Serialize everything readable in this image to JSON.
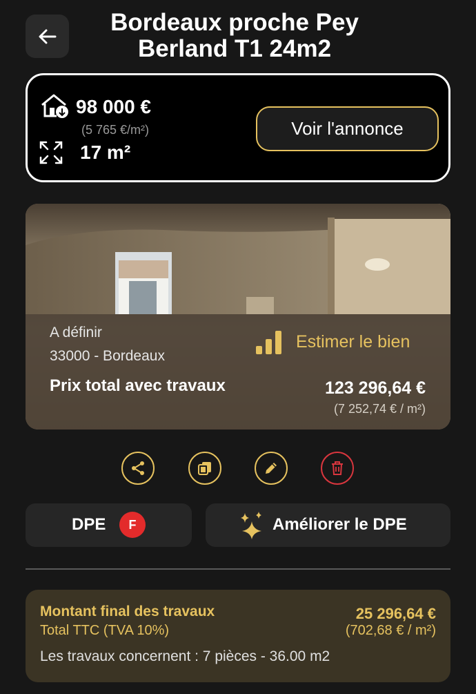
{
  "header": {
    "title": "Bordeaux proche Pey Berland T1 24m2",
    "back_icon": "arrow-left-icon"
  },
  "summary": {
    "price": "98 000 €",
    "price_per_m2": "(5 765 €/m²)",
    "surface": "17 m²",
    "cta_label": "Voir l'annonce",
    "accent_color": "#e6c25f"
  },
  "property": {
    "location_name": "A définir",
    "location_city": "33000 - Bordeaux",
    "estimate_label": "Estimer le bien",
    "total_label": "Prix total avec travaux",
    "total_value": "123 296,64 €",
    "total_per_m2": "(7 252,74 € / m²)"
  },
  "actions": [
    {
      "icon": "share-icon"
    },
    {
      "icon": "copy-icon"
    },
    {
      "icon": "pencil-icon"
    },
    {
      "icon": "trash-icon"
    }
  ],
  "dpe": {
    "label": "DPE",
    "grade": "F",
    "grade_color": "#e32b2b",
    "improve_label": "Améliorer le DPE"
  },
  "works": {
    "title": "Montant final des travaux",
    "subtitle": "Total TTC (TVA 10%)",
    "total": "25 296,64 €",
    "per_m2": "(702,68 € / m²)",
    "description": "Les travaux concernent : 7 pièces - 36.00 m2"
  }
}
